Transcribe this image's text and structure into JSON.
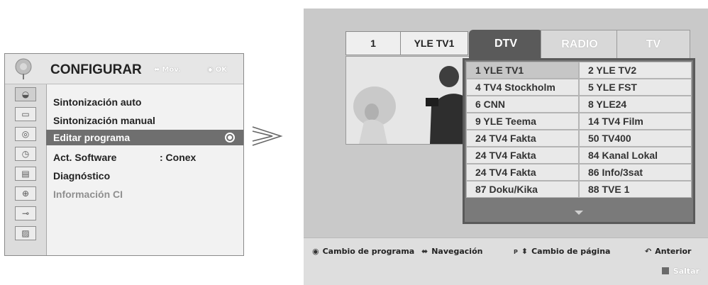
{
  "menu": {
    "title": "CONFIGURAR",
    "hint_move": "Mov.",
    "hint_ok": "OK",
    "items": [
      {
        "label": "Sintonización auto"
      },
      {
        "label": "Sintonización manual"
      },
      {
        "label": "Editar programa"
      },
      {
        "label": "Act. Software",
        "value": ": Conex"
      },
      {
        "label": "Diagnóstico"
      },
      {
        "label": "Información CI"
      }
    ],
    "side_icons": [
      "satellite-dish-icon",
      "tv-screen-icon",
      "speaker-icon",
      "clock-icon",
      "options-icon",
      "lock-icon",
      "input-plug-icon",
      "usb-clapper-icon"
    ]
  },
  "preview": {
    "channel_number": "1",
    "channel_name": "YLE TV1"
  },
  "tabs": [
    {
      "label": "DTV"
    },
    {
      "label": "RADIO"
    },
    {
      "label": "TV"
    }
  ],
  "channels": [
    [
      "1 YLE TV1",
      "2 YLE TV2"
    ],
    [
      "4 TV4 Stockholm",
      "5 YLE FST"
    ],
    [
      "6 CNN",
      "8 YLE24"
    ],
    [
      "9 YLE Teema",
      "14 TV4 Film"
    ],
    [
      "24 TV4 Fakta",
      "50 TV400"
    ],
    [
      "24 TV4 Fakta",
      "84 Kanal Lokal"
    ],
    [
      "24 TV4 Fakta",
      "86 Info/3sat"
    ],
    [
      "87 Doku/Kika",
      "88 TVE 1"
    ]
  ],
  "footer": {
    "change_program": "Cambio de programa",
    "navigation": "Navegación",
    "page_change": "Cambio de página",
    "page_key": "P",
    "previous": "Anterior",
    "skip": "Saltar"
  }
}
